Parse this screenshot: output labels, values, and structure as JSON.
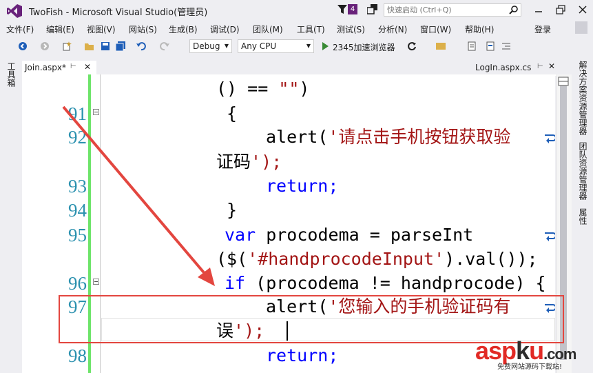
{
  "window": {
    "title": "TwoFish - Microsoft Visual Studio(管理员)",
    "notification_count": "4",
    "quick_launch_placeholder": "快速启动 (Ctrl+Q)"
  },
  "menu": {
    "items": [
      "文件(F)",
      "编辑(E)",
      "视图(V)",
      "网站(S)",
      "生成(B)",
      "调试(D)",
      "团队(M)",
      "工具(T)",
      "测试(S)",
      "分析(N)",
      "窗口(W)",
      "帮助(H)"
    ],
    "sign_in": "登录"
  },
  "toolbar": {
    "configuration": "Debug",
    "platform": "Any CPU",
    "run_target": "2345加速浏览器"
  },
  "side_panels": {
    "left": "工具箱",
    "right": [
      "解决方案资源管理器",
      "团队资源管理器",
      "属性"
    ]
  },
  "tabs": {
    "active": "Join.aspx*",
    "right": "LogIn.aspx.cs"
  },
  "editor": {
    "line_numbers": [
      "91",
      "92",
      "93",
      "94",
      "95",
      "96",
      "97",
      "98"
    ],
    "lines": [
      "() == \"\")",
      "{",
      "alert('请点击手机按钮获取验",
      "证码');",
      "return;",
      "}",
      "var procodema = parseInt",
      "($('#handprocodeInput').val());",
      "if (procodema != handprocode) {",
      "alert('您输入的手机验证码有",
      "误');",
      "return;"
    ]
  },
  "watermark": {
    "brand_a": "asp",
    "brand_b": "k",
    "brand_c": "u",
    "brand_d": ".com",
    "tagline": "免费网站源码下载站!"
  },
  "colors": {
    "keyword": "#0000ff",
    "string": "#a31515",
    "line_number": "#2b91af",
    "annotation": "#e3463f",
    "vs_purple": "#68217a"
  }
}
